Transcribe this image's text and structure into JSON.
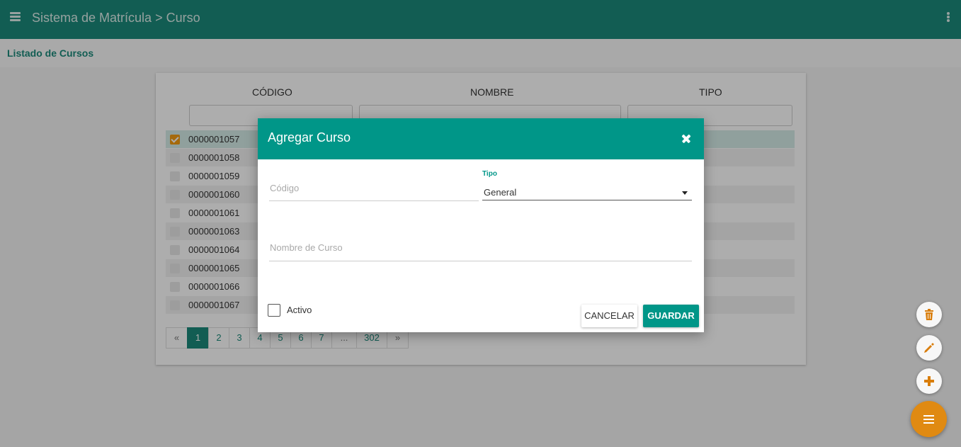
{
  "app": {
    "title": "Sistema de Matrícula > Curso",
    "subtitle": "Listado de Cursos"
  },
  "table": {
    "columns": [
      "CÓDIGO",
      "NOMBRE",
      "TIPO"
    ],
    "rows": [
      {
        "code": "0000001057",
        "selected": true
      },
      {
        "code": "0000001058",
        "selected": false
      },
      {
        "code": "0000001059",
        "selected": false
      },
      {
        "code": "0000001060",
        "selected": false
      },
      {
        "code": "0000001061",
        "selected": false
      },
      {
        "code": "0000001063",
        "selected": false
      },
      {
        "code": "0000001064",
        "selected": false
      },
      {
        "code": "0000001065",
        "selected": false
      },
      {
        "code": "0000001066",
        "selected": false
      },
      {
        "code": "0000001067",
        "selected": false
      }
    ]
  },
  "pagination": {
    "prev": "«",
    "pages": [
      "1",
      "2",
      "3",
      "4",
      "5",
      "6",
      "7",
      "...",
      "302"
    ],
    "next": "»",
    "current": "1"
  },
  "modal": {
    "title": "Agregar Curso",
    "codigo_placeholder": "Código",
    "tipo_label": "Tipo",
    "tipo_value": "General",
    "nombre_placeholder": "Nombre de Curso",
    "activo_label": "Activo",
    "activo_checked": false,
    "cancel_label": "CANCELAR",
    "save_label": "GUARDAR"
  },
  "fabs": [
    "trash-icon",
    "pencil-icon",
    "plus-icon",
    "menu-icon"
  ],
  "colors": {
    "primary": "#1b8a7b",
    "modal_header": "#009688",
    "accent": "#e08a12"
  }
}
